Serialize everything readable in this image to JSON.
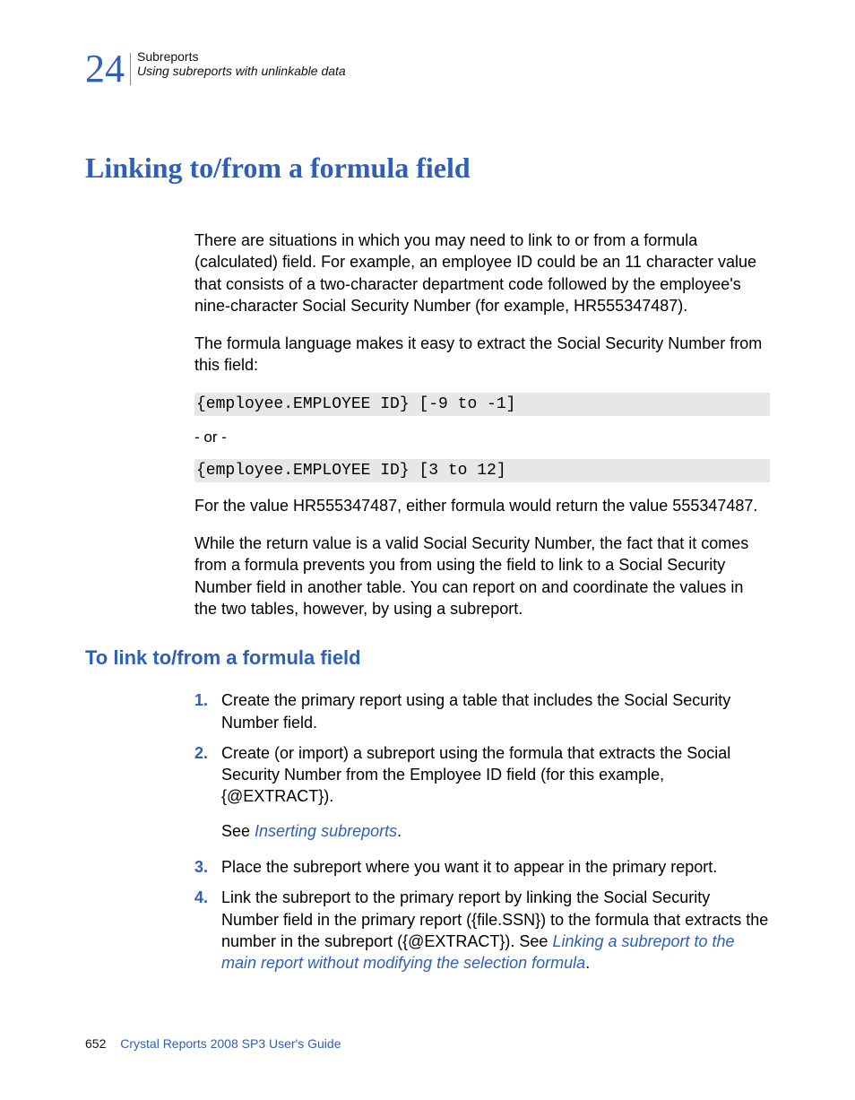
{
  "header": {
    "chapter_num": "24",
    "chapter_title": "Subreports",
    "section_title": "Using subreports with unlinkable data"
  },
  "title": "Linking to/from a formula field",
  "p1": "There are situations in which you may need to link to or from a formula (calculated) field. For example, an employee ID could be an 11 character value that consists of a two-character department code followed by the employee's nine-character Social Security Number (for example, HR555347487).",
  "p2": "The formula language makes it easy to extract the Social Security Number from this field:",
  "code1": "{employee.EMPLOYEE ID} [-9 to -1]",
  "or_text": "- or -",
  "code2": "{employee.EMPLOYEE ID} [3 to 12]",
  "p3": "For the value HR555347487, either formula would return the value 555347487.",
  "p4": "While the return value is a valid Social Security Number, the fact that it comes from a formula prevents you from using the field to link to a Social Security Number field in another table. You can report on and coordinate the values in the two tables, however, by using a subreport.",
  "h3": "To link to/from a formula field",
  "steps": {
    "s1": {
      "num": "1.",
      "text": "Create the primary report using a table that includes the Social Security Number field."
    },
    "s2": {
      "num": "2.",
      "text": "Create (or import) a subreport using the formula that extracts the Social Security Number from the Employee ID field (for this example, {@EXTRACT}).",
      "see_pre": "See ",
      "see_link": "Inserting subreports",
      "see_post": "."
    },
    "s3": {
      "num": "3.",
      "text": "Place the subreport where you want it to appear in the primary report."
    },
    "s4": {
      "num": "4.",
      "pre": "Link the subreport to the primary report by linking the Social Security Number field in the primary report ({file.SSN}) to the formula that extracts the number in the subreport ({@EXTRACT}). See ",
      "link": "Linking a subreport to the main report without modifying the selection formula",
      "post": "."
    }
  },
  "footer": {
    "page": "652",
    "book": "Crystal Reports 2008 SP3 User's Guide"
  }
}
